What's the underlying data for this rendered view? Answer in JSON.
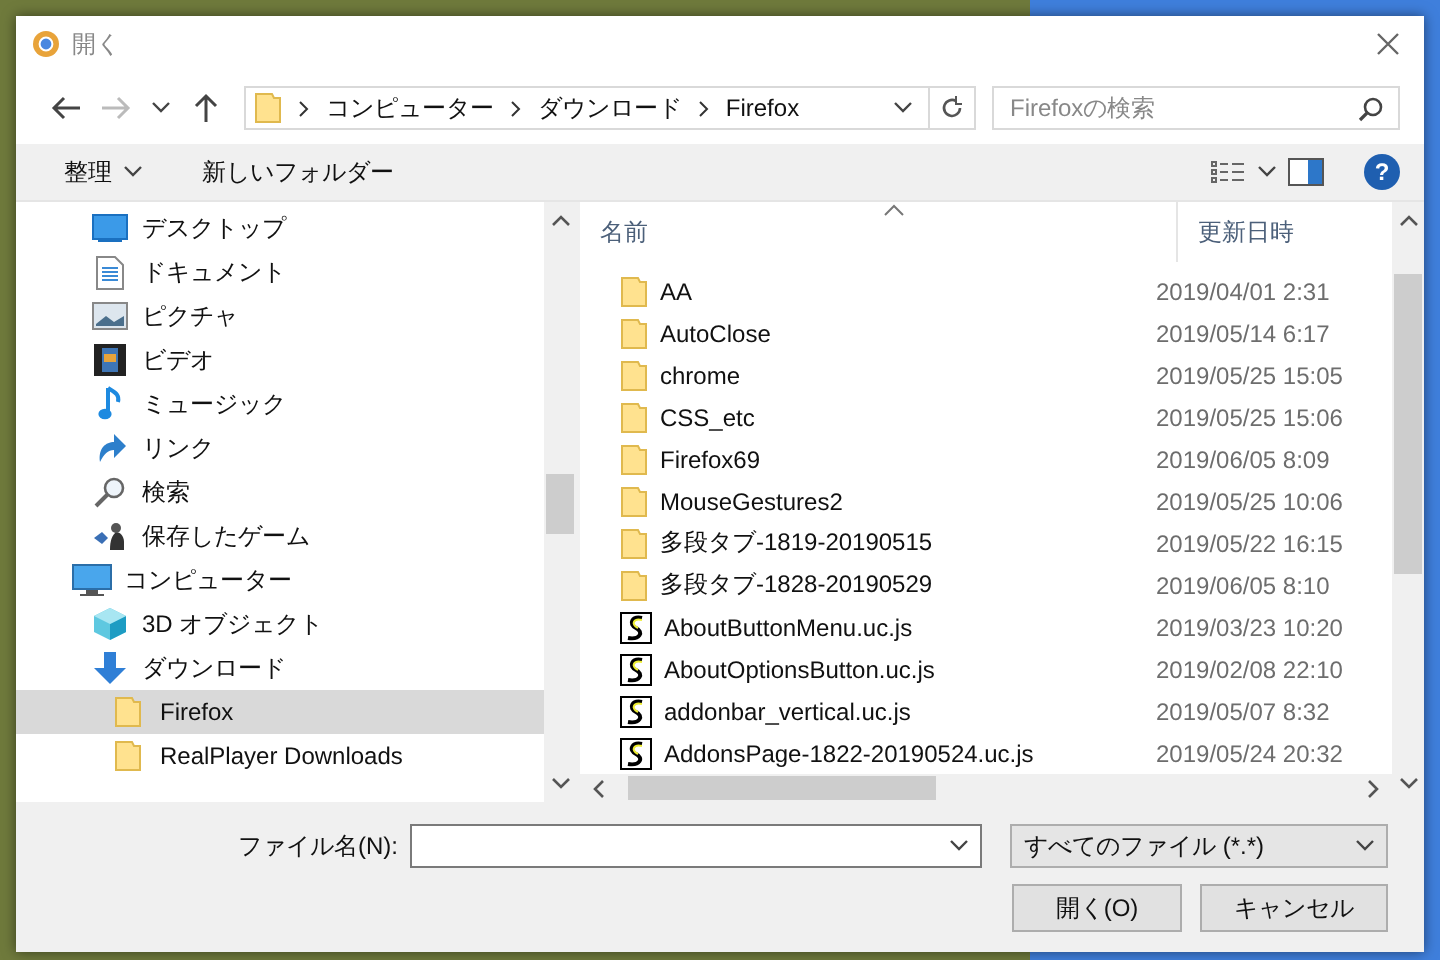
{
  "window": {
    "title": "開く"
  },
  "navigation": {
    "back": {
      "disabled": false
    },
    "forward": {
      "disabled": true
    },
    "breadcrumb": [
      "コンピューター",
      "ダウンロード",
      "Firefox"
    ],
    "search": {
      "placeholder": "Firefoxの検索"
    }
  },
  "toolbar": {
    "organize": "整理",
    "new_folder": "新しいフォルダー",
    "help": "?"
  },
  "sidebar": {
    "items": [
      {
        "children": [
          {
            "label": "デスクトップ",
            "kind": "desktop",
            "selected": false
          },
          {
            "label": "ドキュメント",
            "kind": "document",
            "selected": false
          },
          {
            "label": "ピクチャ",
            "kind": "picture",
            "selected": false
          },
          {
            "label": "ビデオ",
            "kind": "video",
            "selected": false
          },
          {
            "label": "ミュージック",
            "kind": "music",
            "selected": false
          },
          {
            "label": "リンク",
            "kind": "link",
            "selected": false
          },
          {
            "label": "検索",
            "kind": "search",
            "selected": false
          },
          {
            "label": "保存したゲーム",
            "kind": "games",
            "selected": false
          }
        ]
      },
      {
        "label": "コンピューター",
        "kind": "computer",
        "selected": false,
        "children": [
          {
            "label": "3D オブジェクト",
            "kind": "cube",
            "selected": false
          },
          {
            "label": "ダウンロード",
            "kind": "download",
            "selected": false,
            "children": [
              {
                "label": "Firefox",
                "kind": "folder",
                "selected": true
              },
              {
                "label": "RealPlayer Downloads",
                "kind": "folder",
                "selected": false
              }
            ]
          }
        ]
      }
    ]
  },
  "file_list": {
    "columns": [
      "名前",
      "更新日時"
    ],
    "rows": [
      {
        "name": "AA",
        "modified": "2019/04/01 2:31",
        "kind": "folder"
      },
      {
        "name": "AutoClose",
        "modified": "2019/05/14 6:17",
        "kind": "folder"
      },
      {
        "name": "chrome",
        "modified": "2019/05/25 15:05",
        "kind": "folder"
      },
      {
        "name": "CSS_etc",
        "modified": "2019/05/25 15:06",
        "kind": "folder"
      },
      {
        "name": "Firefox69",
        "modified": "2019/06/05 8:09",
        "kind": "folder"
      },
      {
        "name": "MouseGestures2",
        "modified": "2019/05/25 10:06",
        "kind": "folder"
      },
      {
        "name": "多段タブ-1819-20190515",
        "modified": "2019/05/22 16:15",
        "kind": "folder"
      },
      {
        "name": "多段タブ-1828-20190529",
        "modified": "2019/06/05 8:10",
        "kind": "folder"
      },
      {
        "name": "AboutButtonMenu.uc.js",
        "modified": "2019/03/23 10:20",
        "kind": "script"
      },
      {
        "name": "AboutOptionsButton.uc.js",
        "modified": "2019/02/08 22:10",
        "kind": "script"
      },
      {
        "name": "addonbar_vertical.uc.js",
        "modified": "2019/05/07 8:32",
        "kind": "script"
      },
      {
        "name": "AddonsPage-1822-20190524.uc.js",
        "modified": "2019/05/24 20:32",
        "kind": "script"
      }
    ]
  },
  "footer": {
    "filename_label": "ファイル名(N):",
    "file_type": "すべてのファイル (*.*)",
    "buttons": [
      "開く(O)",
      "キャンセル"
    ]
  }
}
